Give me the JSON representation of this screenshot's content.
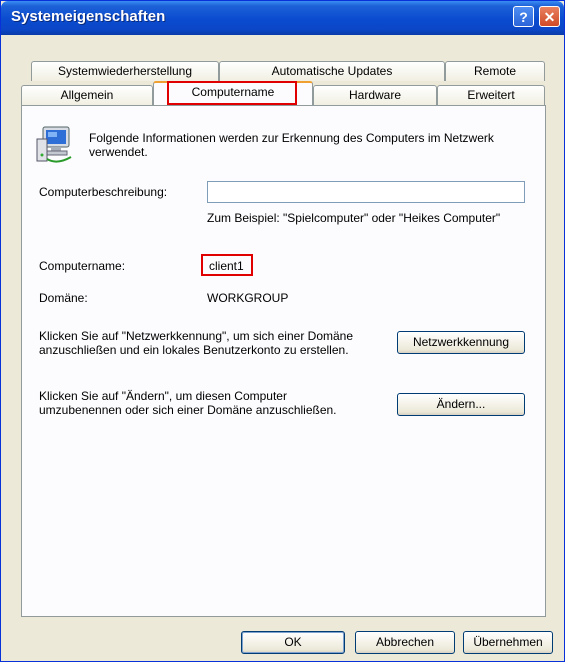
{
  "window": {
    "title": "Systemeigenschaften",
    "help_glyph": "?",
    "close_glyph": "✕"
  },
  "tabs": {
    "row1": [
      "Systemwiederherstellung",
      "Automatische Updates",
      "Remote"
    ],
    "row2": [
      "Allgemein",
      "Computername",
      "Hardware",
      "Erweitert"
    ],
    "active": "Computername"
  },
  "content": {
    "info_text": "Folgende Informationen werden zur Erkennung des Computers im Netzwerk verwendet.",
    "description_label": "Computerbeschreibung:",
    "description_value": "",
    "example_text": "Zum Beispiel: \"Spielcomputer\" oder \"Heikes Computer\"",
    "computername_label": "Computername:",
    "computername_value": "client1",
    "domain_label": "Domäne:",
    "domain_value": "WORKGROUP",
    "network_id_text": "Klicken Sie auf \"Netzwerkkennung\", um sich einer Domäne anzuschließen und ein lokales Benutzerkonto zu erstellen.",
    "network_id_button": "Netzwerkkennung",
    "change_text": "Klicken Sie auf \"Ändern\", um diesen Computer umzubenennen oder sich einer Domäne anzuschließen.",
    "change_button": "Ändern..."
  },
  "footer": {
    "ok": "OK",
    "cancel": "Abbrechen",
    "apply": "Übernehmen"
  },
  "icons": {
    "computer": "network-computer-icon"
  },
  "colors": {
    "titlebar": "#0a4bd0",
    "highlight": "#e00000",
    "dialog_bg": "#ece9d8"
  }
}
